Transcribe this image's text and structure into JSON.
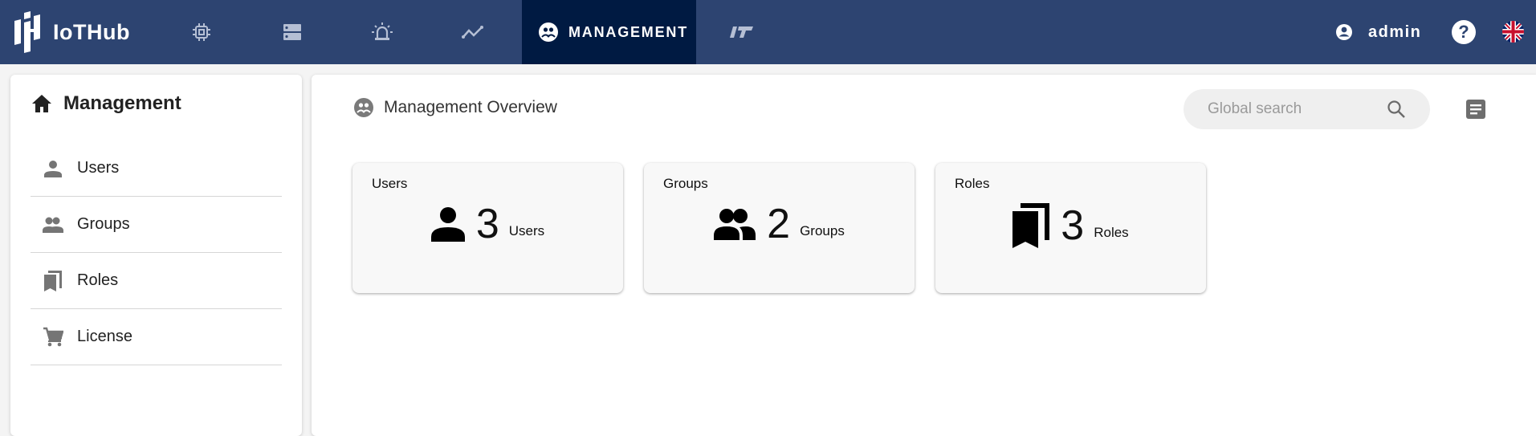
{
  "app": {
    "name": "IoTHub",
    "brand_color": "#2d4471",
    "active_color": "#001a42"
  },
  "topnav": {
    "items": [
      {
        "icon": "chip-icon",
        "label": "Devices"
      },
      {
        "icon": "server-icon",
        "label": "Storage"
      },
      {
        "icon": "alarm-icon",
        "label": "Alarms"
      },
      {
        "icon": "trend-icon",
        "label": "Analytics"
      },
      {
        "icon": "management-icon",
        "label": "MANAGEMENT",
        "active": true
      },
      {
        "icon": "flow-icon",
        "label": "Flows"
      }
    ],
    "active_label": "MANAGEMENT",
    "user": "admin",
    "help": "?",
    "language": "en-GB"
  },
  "sidebar": {
    "title": "Management",
    "items": [
      {
        "label": "Users",
        "icon": "person-icon"
      },
      {
        "label": "Groups",
        "icon": "group-icon"
      },
      {
        "label": "Roles",
        "icon": "bookmarks-icon"
      },
      {
        "label": "License",
        "icon": "cart-icon"
      }
    ]
  },
  "main": {
    "title": "Management Overview",
    "search": {
      "placeholder": "Global search",
      "value": ""
    },
    "cards": [
      {
        "title": "Users",
        "count": "3",
        "unit": "Users",
        "icon": "person-icon"
      },
      {
        "title": "Groups",
        "count": "2",
        "unit": "Groups",
        "icon": "group-icon"
      },
      {
        "title": "Roles",
        "count": "3",
        "unit": "Roles",
        "icon": "bookmarks-icon"
      }
    ]
  }
}
